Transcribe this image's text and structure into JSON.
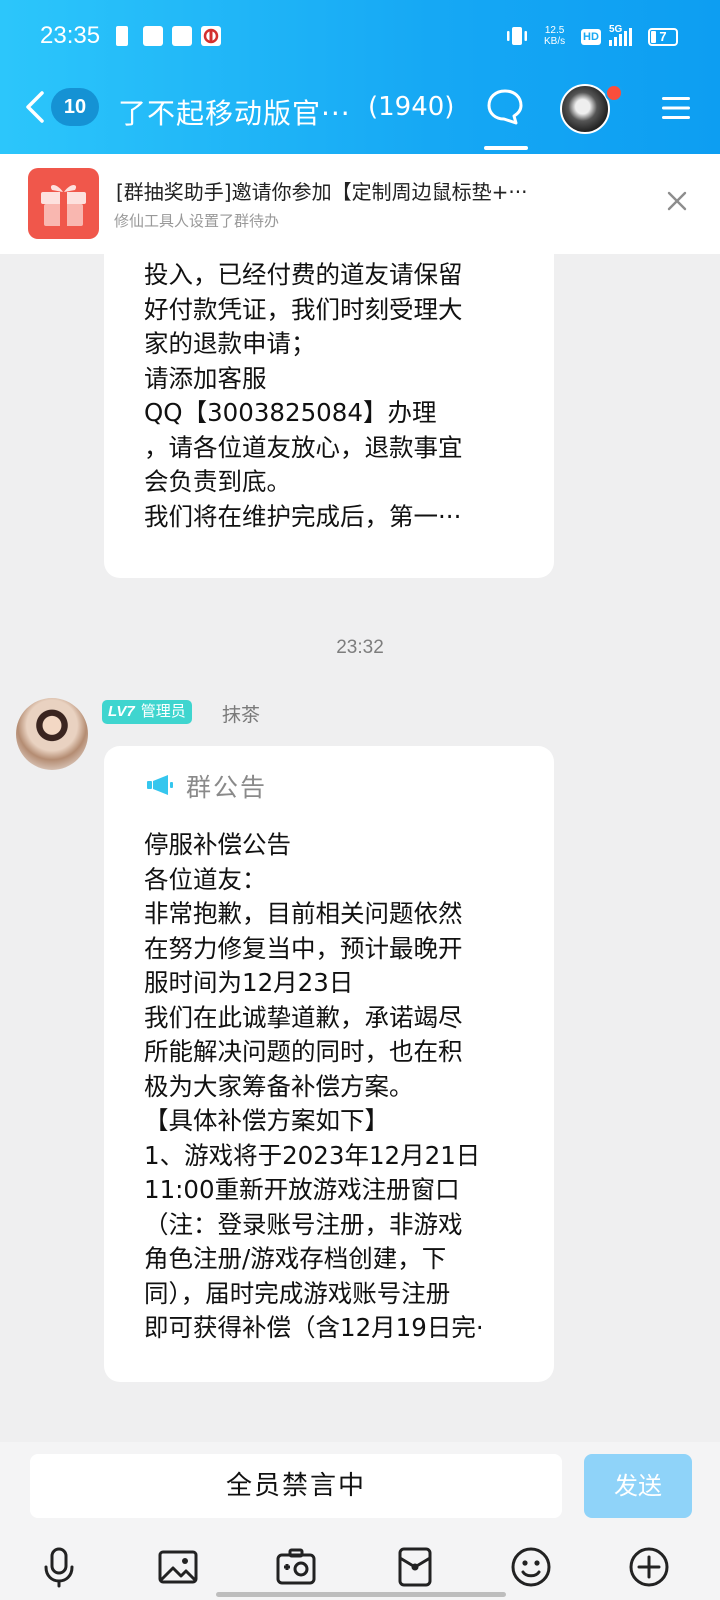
{
  "status_bar": {
    "time": "23:35",
    "net_speed_value": "12.5",
    "net_speed_unit": "KB/s",
    "hd": "HD",
    "signal": "5G",
    "battery": "7"
  },
  "header": {
    "unread_count": "10",
    "group_title": "了不起移动版官···",
    "member_count": "(1940)"
  },
  "notice_banner": {
    "title": "[群抽奖助手]邀请你参加【定制周边鼠标垫+···",
    "subtitle": "修仙工具人设置了群待办"
  },
  "messages": {
    "first": {
      "lines": [
        "投入，已经付费的道友请保留",
        "好付款凭证，我们时刻受理大",
        "家的退款申请；",
        "请添加客服",
        "QQ【3003825084】办理",
        "，请各位道友放心，退款事宜",
        "会负责到底。",
        "我们将在维护完成后，第一···"
      ]
    },
    "timestamp": "23:32",
    "second": {
      "level": "LV7",
      "role": "管理员",
      "sender": "抹茶",
      "announcement_label": "群公告",
      "lines": [
        "停服补偿公告",
        "各位道友：",
        "非常抱歉，目前相关问题依然",
        "在努力修复当中，预计最晚开",
        "服时间为12月23日",
        "我们在此诚挚道歉，承诺竭尽",
        "所能解决问题的同时，也在积",
        "极为大家筹备补偿方案。",
        "【具体补偿方案如下】",
        "1、游戏将于2023年12月21日",
        "11:00重新开放游戏注册窗口",
        "（注：登录账号注册，非游戏",
        "角色注册/游戏存档创建，下",
        "同），届时完成游戏账号注册",
        "即可获得补偿（含12月19日完·"
      ]
    }
  },
  "input_bar": {
    "muted_text": "全员禁言中",
    "send_label": "发送"
  },
  "toolbar_icons": [
    "microphone-icon",
    "image-icon",
    "camera-icon",
    "red-packet-icon",
    "emoji-icon",
    "plus-icon"
  ],
  "colors": {
    "header_blue": "#16a8f4",
    "badge_teal": "#3fd5cf",
    "send_disabled": "#8fd3f9",
    "gift_red": "#f0574b"
  }
}
